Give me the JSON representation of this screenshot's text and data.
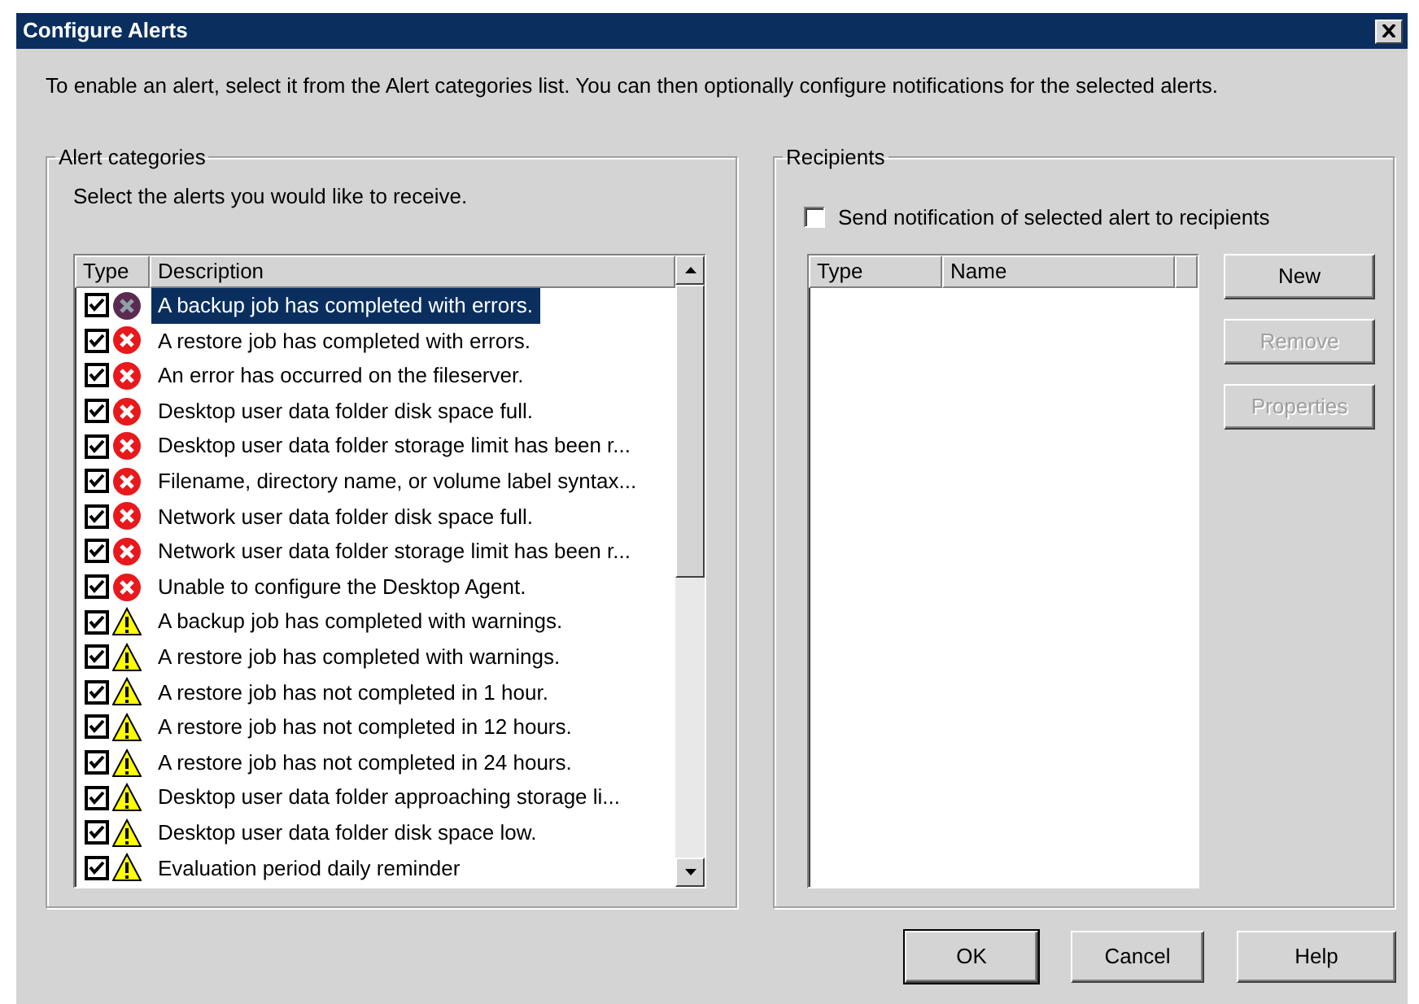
{
  "window": {
    "title": "Configure Alerts"
  },
  "intro": "To enable an alert, select it from the Alert categories list. You can then optionally configure notifications for the selected alerts.",
  "alert_categories": {
    "label": "Alert categories",
    "instruction": "Select the alerts you would like to receive.",
    "columns": [
      "Type",
      "Description"
    ],
    "rows": [
      {
        "enabled": true,
        "kind": "error",
        "description": "A backup job has completed with errors.",
        "selected": true
      },
      {
        "enabled": true,
        "kind": "error",
        "description": "A restore job has completed with errors.",
        "selected": false
      },
      {
        "enabled": true,
        "kind": "error",
        "description": "An error has occurred on the fileserver.",
        "selected": false
      },
      {
        "enabled": true,
        "kind": "error",
        "description": "Desktop user data folder disk space full.",
        "selected": false
      },
      {
        "enabled": true,
        "kind": "error",
        "description": "Desktop user data folder storage limit has been r...",
        "selected": false
      },
      {
        "enabled": true,
        "kind": "error",
        "description": "Filename, directory name, or volume label syntax...",
        "selected": false
      },
      {
        "enabled": true,
        "kind": "error",
        "description": "Network user data folder disk space full.",
        "selected": false
      },
      {
        "enabled": true,
        "kind": "error",
        "description": "Network user data folder storage limit has been r...",
        "selected": false
      },
      {
        "enabled": true,
        "kind": "error",
        "description": "Unable to configure the Desktop Agent.",
        "selected": false
      },
      {
        "enabled": true,
        "kind": "warning",
        "description": "A backup job has completed with warnings.",
        "selected": false
      },
      {
        "enabled": true,
        "kind": "warning",
        "description": "A restore job has completed with warnings.",
        "selected": false
      },
      {
        "enabled": true,
        "kind": "warning",
        "description": "A restore job has not completed in 1 hour.",
        "selected": false
      },
      {
        "enabled": true,
        "kind": "warning",
        "description": "A restore job has not completed in 12 hours.",
        "selected": false
      },
      {
        "enabled": true,
        "kind": "warning",
        "description": "A restore job has not completed in 24 hours.",
        "selected": false
      },
      {
        "enabled": true,
        "kind": "warning",
        "description": "Desktop user data folder approaching storage li...",
        "selected": false
      },
      {
        "enabled": true,
        "kind": "warning",
        "description": "Desktop user data folder disk space low.",
        "selected": false
      },
      {
        "enabled": true,
        "kind": "warning",
        "description": "Evaluation period daily reminder",
        "selected": false
      }
    ]
  },
  "recipients": {
    "label": "Recipients",
    "notify": {
      "label": "Send notification of selected alert to recipients",
      "checked": false
    },
    "columns": [
      "Type",
      "Name"
    ],
    "buttons": [
      {
        "label": "New",
        "disabled": false
      },
      {
        "label": "Remove",
        "disabled": true
      },
      {
        "label": "Properties",
        "disabled": true
      }
    ]
  },
  "footer_buttons": [
    {
      "label": "OK",
      "default": true
    },
    {
      "label": "Cancel",
      "default": false
    },
    {
      "label": "Help",
      "default": false
    }
  ]
}
